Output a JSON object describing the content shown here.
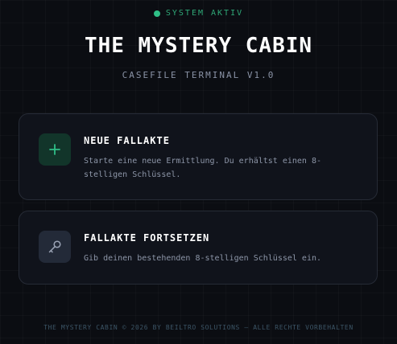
{
  "status": {
    "text": "SYSTEM AKTIV",
    "color": "#2fbf87"
  },
  "header": {
    "title": "THE MYSTERY CABIN",
    "subtitle": "CASEFILE TERMINAL V1.0"
  },
  "cards": [
    {
      "icon": "plus-icon",
      "title": "NEUE FALLAKTE",
      "description": "Starte eine neue Ermittlung. Du erhältst einen 8-stelligen Schlüssel.",
      "accent": "#2fbf87"
    },
    {
      "icon": "key-icon",
      "title": "FALLAKTE FORTSETZEN",
      "description": "Gib deinen bestehenden 8-stelligen Schlüssel ein.",
      "accent": "#8a93a6"
    }
  ],
  "footer": {
    "text": "THE MYSTERY CABIN © 2026 BY BEILTRO SOLUTIONS — ALLE RECHTE VORBEHALTEN"
  }
}
